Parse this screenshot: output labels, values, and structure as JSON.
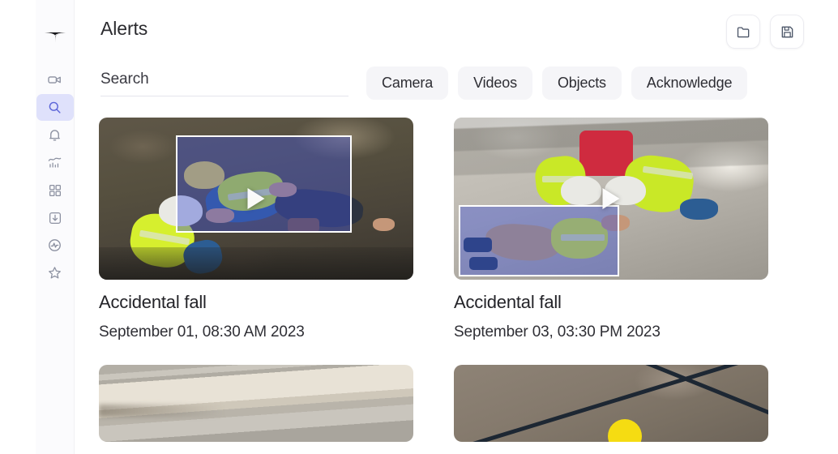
{
  "app": {
    "logo_name": "sparkle-logo",
    "accent_color": "#5b64d8",
    "accent_bg_color": "#dfe1fb",
    "chip_bg_color": "#f5f5f8",
    "detection_box_color": "#4054d6"
  },
  "sidebar": {
    "items": [
      {
        "name": "cameras",
        "icon": "video-camera-icon",
        "active": false
      },
      {
        "name": "search",
        "icon": "search-icon",
        "active": true
      },
      {
        "name": "alerts",
        "icon": "bell-icon",
        "active": false
      },
      {
        "name": "analytics",
        "icon": "chart-icon",
        "active": false
      },
      {
        "name": "dashboard",
        "icon": "grid-icon",
        "active": false
      },
      {
        "name": "downloads",
        "icon": "download-box-icon",
        "active": false
      },
      {
        "name": "activity",
        "icon": "activity-circle-icon",
        "active": false
      },
      {
        "name": "favorites",
        "icon": "star-icon",
        "active": false
      }
    ]
  },
  "header": {
    "title": "Alerts",
    "actions": [
      {
        "name": "open-folder",
        "icon": "folder-icon"
      },
      {
        "name": "save",
        "icon": "save-disk-icon"
      }
    ]
  },
  "search": {
    "placeholder": "Search",
    "value": ""
  },
  "filters": [
    {
      "label": "Camera"
    },
    {
      "label": "Videos"
    },
    {
      "label": "Objects"
    },
    {
      "label": "Acknowledge"
    }
  ],
  "alerts": [
    {
      "title": "Accidental fall",
      "timestamp": "September 01, 08:30 AM 2023"
    },
    {
      "title": "Accidental fall",
      "timestamp": "September 03, 03:30 PM 2023"
    },
    {
      "title": "",
      "timestamp": ""
    },
    {
      "title": "",
      "timestamp": ""
    }
  ]
}
